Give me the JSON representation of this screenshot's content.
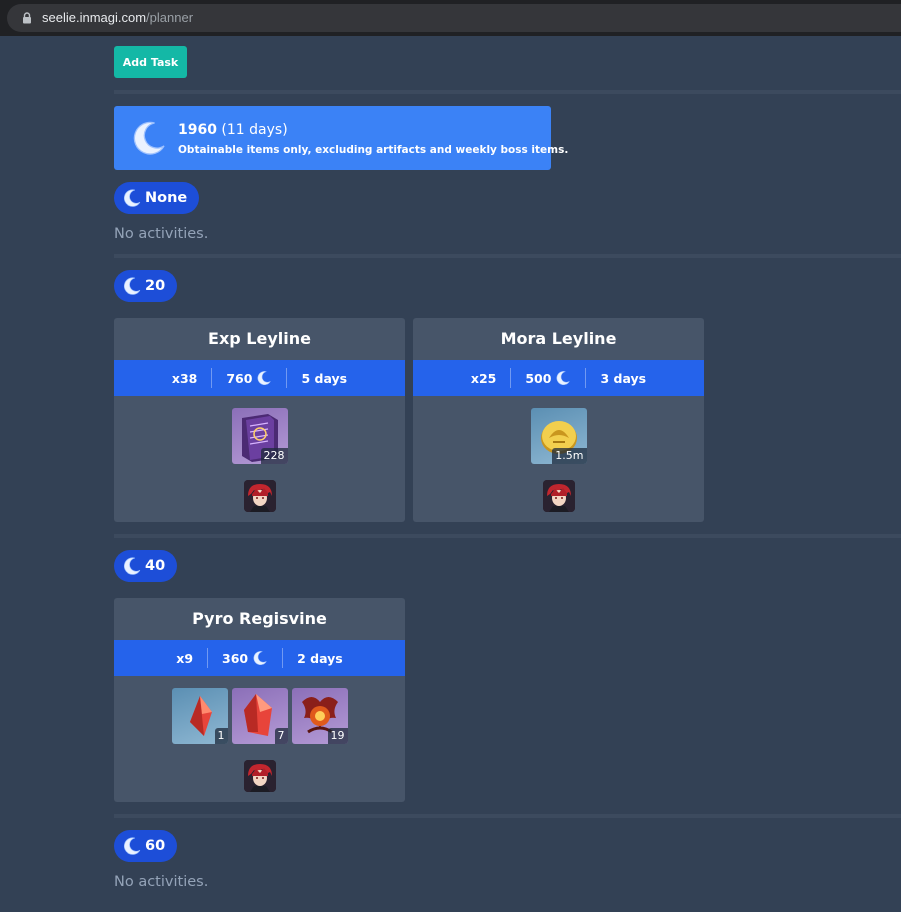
{
  "browser": {
    "url_domain": "seelie.inmagi.com",
    "url_path": "/planner"
  },
  "toolbar": {
    "add_task_label": "Add Task"
  },
  "summary": {
    "total": "1960",
    "days": "(11 days)",
    "note": "Obtainable items only, excluding artifacts and weekly boss items."
  },
  "groups": [
    {
      "label": "None",
      "empty_text": "No activities."
    },
    {
      "label": "20",
      "cards": [
        {
          "title": "Exp Leyline",
          "count": "x38",
          "resin": "760",
          "duration": "5 days",
          "items": [
            {
              "icon": "book-icon",
              "qty": "228"
            }
          ]
        },
        {
          "title": "Mora Leyline",
          "count": "x25",
          "resin": "500",
          "duration": "3 days",
          "items": [
            {
              "icon": "mora-coin-icon",
              "qty": "1.5m"
            }
          ]
        }
      ]
    },
    {
      "label": "40",
      "cards": [
        {
          "title": "Pyro Regisvine",
          "count": "x9",
          "resin": "360",
          "duration": "2 days",
          "items": [
            {
              "icon": "pyro-sliver-icon",
              "qty": "1"
            },
            {
              "icon": "pyro-chunk-icon",
              "qty": "7"
            },
            {
              "icon": "everflame-seed-icon",
              "qty": "19"
            }
          ]
        }
      ]
    },
    {
      "label": "60",
      "empty_text": "No activities."
    }
  ],
  "colors": {
    "background": "#334155",
    "card": "#475569",
    "accent_blue": "#2563eb",
    "info_blue": "#3b82f6",
    "pill_blue": "#1d4ed8",
    "teal_button": "#14b8a6"
  }
}
